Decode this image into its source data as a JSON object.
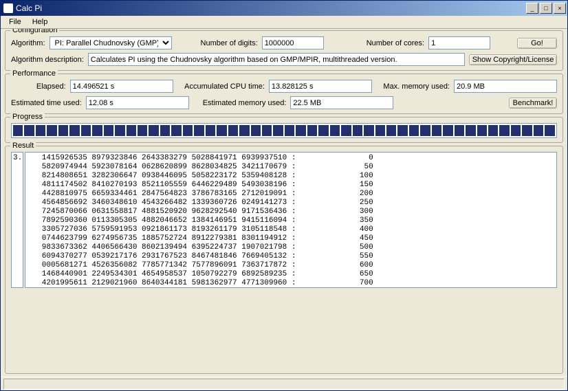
{
  "window": {
    "title": "Calc Pi"
  },
  "menu": {
    "file": "File",
    "help": "Help"
  },
  "config": {
    "legend": "Configuration",
    "algorithm_label": "Algorithm:",
    "algorithm_value": "PI: Parallel Chudnovsky (GMP)",
    "digits_label": "Number of digits:",
    "digits_value": "1000000",
    "cores_label": "Number of cores:",
    "cores_value": "1",
    "go_label": "Go!",
    "desc_label": "Algorithm description:",
    "desc_value": "Calculates PI using the Chudnovsky algorithm based on GMP/MPIR, multithreaded version.",
    "license_label": "Show Copyright/License"
  },
  "perf": {
    "legend": "Performance",
    "elapsed_label": "Elapsed:",
    "elapsed_value": "14.496521 s",
    "cpu_label": "Accumulated CPU time:",
    "cpu_value": "13.828125 s",
    "mem_label": "Max. memory used:",
    "mem_value": "20.9 MB",
    "est_time_label": "Estimated time used:",
    "est_time_value": "12.08 s",
    "est_mem_label": "Estimated memory used:",
    "est_mem_value": "22.5 MB",
    "bench_label": "Benchmark!"
  },
  "progress": {
    "legend": "Progress",
    "segments": 48
  },
  "result": {
    "legend": "Result",
    "prefix": "3.",
    "lines": [
      "   1415926535 8979323846 2643383279 5028841971 6939937510 :                0",
      "   5820974944 5923078164 0628620899 8628034825 3421170679 :               50",
      "   8214808651 3282306647 0938446095 5058223172 5359408128 :              100",
      "   4811174502 8410270193 8521105559 6446229489 5493038196 :              150",
      "   4428810975 6659334461 2847564823 3786783165 2712019091 :              200",
      "   4564856692 3460348610 4543266482 1339360726 0249141273 :              250",
      "   7245870066 0631558817 4881520920 9628292540 9171536436 :              300",
      "   7892590360 0113305305 4882046652 1384146951 9415116094 :              350",
      "   3305727036 5759591953 0921861173 8193261179 3105118548 :              400",
      "   0744623799 6274956735 1885752724 8912279381 8301194912 :              450",
      "   9833673362 4406566430 8602139494 6395224737 1907021798 :              500",
      "   6094370277 0539217176 2931767523 8467481846 7669405132 :              550",
      "   0005681271 4526356082 7785771342 7577896091 7363717872 :              600",
      "   1468440901 2249534301 4654958537 1050792279 6892589235 :              650",
      "   4201995611 2129021960 8640344181 5981362977 4771309960 :              700"
    ]
  }
}
